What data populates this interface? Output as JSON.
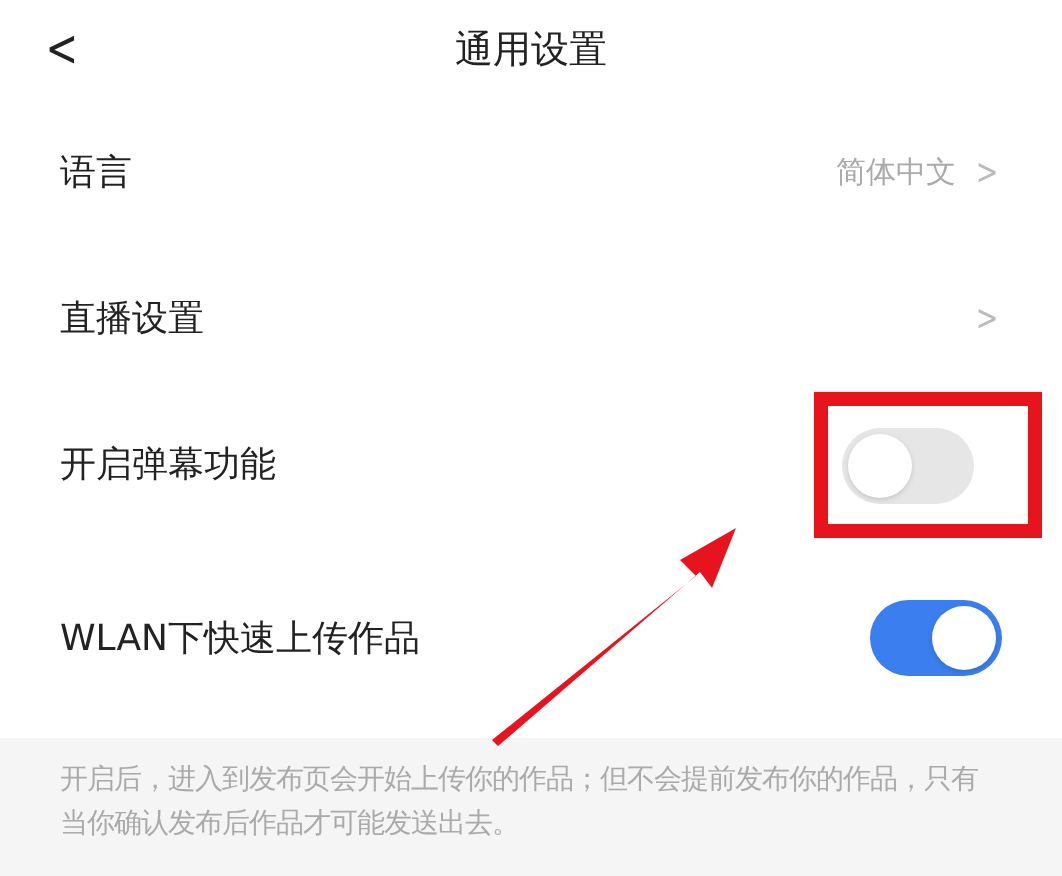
{
  "header": {
    "back": "<",
    "title": "通用设置"
  },
  "rows": [
    {
      "kind": "link",
      "label": "语言",
      "value": "简体中文",
      "chevron": ">"
    },
    {
      "kind": "link",
      "label": "直播设置",
      "chevron": ">"
    },
    {
      "kind": "toggle",
      "label": "开启弹幕功能",
      "on": false,
      "highlighted": true
    },
    {
      "kind": "toggle",
      "label": "WLAN下快速上传作品",
      "on": true,
      "highlighted": false
    }
  ],
  "footnote": "开启后，进入到发布页会开始上传你的作品；但不会提前发布你的作品，只有当你确认发布后作品才可能发送出去。"
}
